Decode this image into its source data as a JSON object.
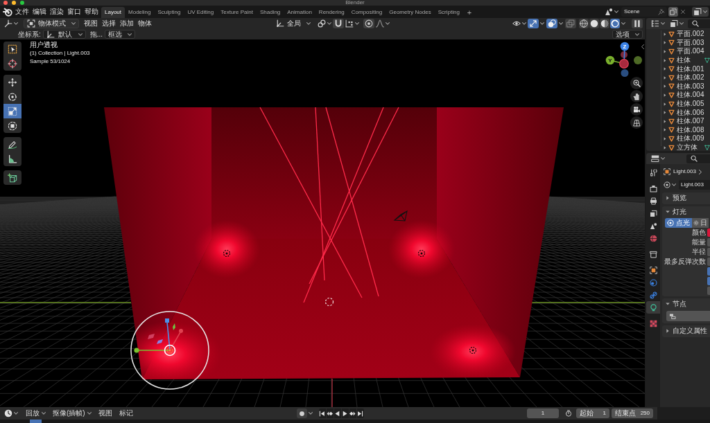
{
  "window": {
    "title": "Blender",
    "buttons": [
      {
        "color": "#ff5f57"
      },
      {
        "color": "#febc2e"
      },
      {
        "color": "#28c840"
      }
    ]
  },
  "top_bar": {
    "menus": [
      "文件",
      "编辑",
      "渲染",
      "窗口",
      "帮助"
    ],
    "workspaces": [
      {
        "label": "Layout",
        "selected": true
      },
      {
        "label": "Modeling",
        "selected": false
      },
      {
        "label": "Sculpting",
        "selected": false
      },
      {
        "label": "UV Editing",
        "selected": false
      },
      {
        "label": "Texture Paint",
        "selected": false
      },
      {
        "label": "Shading",
        "selected": false
      },
      {
        "label": "Animation",
        "selected": false
      },
      {
        "label": "Rendering",
        "selected": false
      },
      {
        "label": "Compositing",
        "selected": false
      },
      {
        "label": "Geometry Nodes",
        "selected": false
      },
      {
        "label": "Scripting",
        "selected": false
      }
    ],
    "add_workspace": "+",
    "scene": "Scene"
  },
  "viewport_header": {
    "mode": "物体模式",
    "menus": [
      "视图",
      "选择",
      "添加",
      "物体"
    ],
    "orientation": "全局",
    "view_toggles": [
      {
        "kind": "gizmos",
        "on": true
      },
      {
        "kind": "overlays",
        "on": true
      },
      {
        "kind": "xray",
        "on": false
      }
    ],
    "shading_modes": [
      {
        "kind": "wireframe",
        "selected": false
      },
      {
        "kind": "solid",
        "selected": false
      },
      {
        "kind": "material",
        "selected": false
      },
      {
        "kind": "rendered",
        "selected": true
      }
    ]
  },
  "tool_settings": {
    "orientation_label": "坐标系:",
    "orientation": "默认",
    "drag_label": "拖...",
    "drag": "框选",
    "options": "选项"
  },
  "toolbar": [
    {
      "tools": [
        {
          "kind": "select_box",
          "selected": false
        },
        {
          "kind": "cursor",
          "selected": false
        }
      ]
    },
    {
      "tools": [
        {
          "kind": "move",
          "selected": false
        },
        {
          "kind": "rotate",
          "selected": false
        },
        {
          "kind": "scale",
          "selected": true
        },
        {
          "kind": "transform",
          "selected": false
        }
      ]
    },
    {
      "tools": [
        {
          "kind": "annotate",
          "selected": false
        },
        {
          "kind": "measure",
          "selected": false
        }
      ]
    },
    {
      "tools": [
        {
          "kind": "add_cube",
          "selected": false
        }
      ]
    }
  ],
  "viewport": {
    "info": [
      "用户透视",
      "(1) Collection | Light.003",
      "Sample 53/1024"
    ],
    "axes": [
      {
        "kind": "z",
        "label": "Z"
      },
      {
        "kind": "y",
        "label": "Y"
      }
    ]
  },
  "outliner": {
    "items": [
      {
        "name": "平面.002",
        "extra_icon": false
      },
      {
        "name": "平面.003",
        "extra_icon": false
      },
      {
        "name": "平面.004",
        "extra_icon": false
      },
      {
        "name": "柱体",
        "extra_icon": true
      },
      {
        "name": "柱体.001",
        "extra_icon": false
      },
      {
        "name": "柱体.002",
        "extra_icon": false
      },
      {
        "name": "柱体.003",
        "extra_icon": false
      },
      {
        "name": "柱体.004",
        "extra_icon": false
      },
      {
        "name": "柱体.005",
        "extra_icon": false
      },
      {
        "name": "柱体.006",
        "extra_icon": false
      },
      {
        "name": "柱体.007",
        "extra_icon": false
      },
      {
        "name": "柱体.008",
        "extra_icon": false
      },
      {
        "name": "柱体.009",
        "extra_icon": false
      },
      {
        "name": "立方体",
        "extra_icon": true
      }
    ]
  },
  "properties": {
    "tab_groups": [
      {
        "tabs": [
          {
            "kind": "tool",
            "selected": false
          }
        ]
      },
      {
        "tabs": [
          {
            "kind": "render",
            "selected": false
          },
          {
            "kind": "output",
            "selected": false
          },
          {
            "kind": "view_layer",
            "selected": false
          },
          {
            "kind": "scene",
            "selected": false
          },
          {
            "kind": "world",
            "selected": false
          }
        ]
      },
      {
        "tabs": [
          {
            "kind": "collection",
            "selected": false
          }
        ]
      },
      {
        "tabs": [
          {
            "kind": "object",
            "selected": false
          },
          {
            "kind": "physics",
            "selected": false
          },
          {
            "kind": "constraints",
            "selected": false
          },
          {
            "kind": "data",
            "selected": true
          }
        ]
      },
      {
        "tabs": [
          {
            "kind": "texture",
            "selected": false
          }
        ]
      }
    ],
    "object": "Light.003",
    "data": "Light.003",
    "panels": [
      {
        "kind": "preview",
        "title": "预览",
        "expanded": false
      },
      {
        "kind": "light",
        "title": "灯光",
        "expanded": true
      },
      {
        "kind": "nodes",
        "title": "节点",
        "expanded": true
      },
      {
        "kind": "custom",
        "title": "自定义属性",
        "expanded": false
      }
    ],
    "light_types": [
      {
        "kind": "point",
        "label": "点光",
        "selected": true
      },
      {
        "kind": "sun",
        "label": "日",
        "selected": false
      }
    ],
    "fields": [
      {
        "kind": "color",
        "label": "颜色",
        "color": "#d8163a"
      },
      {
        "kind": "number",
        "label": "能量"
      },
      {
        "kind": "number",
        "label": "半径"
      },
      {
        "kind": "number",
        "label": "最多反弹次数"
      },
      {
        "kind": "checkbox",
        "checked": true
      },
      {
        "kind": "checkbox",
        "checked": true
      },
      {
        "kind": "number"
      }
    ]
  },
  "timeline": {
    "menus": [
      {
        "label": "回放",
        "dropdown": true
      },
      {
        "label": "抠像(插帧)",
        "dropdown": true
      },
      {
        "label": "视图",
        "dropdown": false
      },
      {
        "label": "标记",
        "dropdown": false
      }
    ],
    "current_frame": "1",
    "start_label": "起始",
    "start": "1",
    "end_label": "结束点",
    "end": "250"
  }
}
